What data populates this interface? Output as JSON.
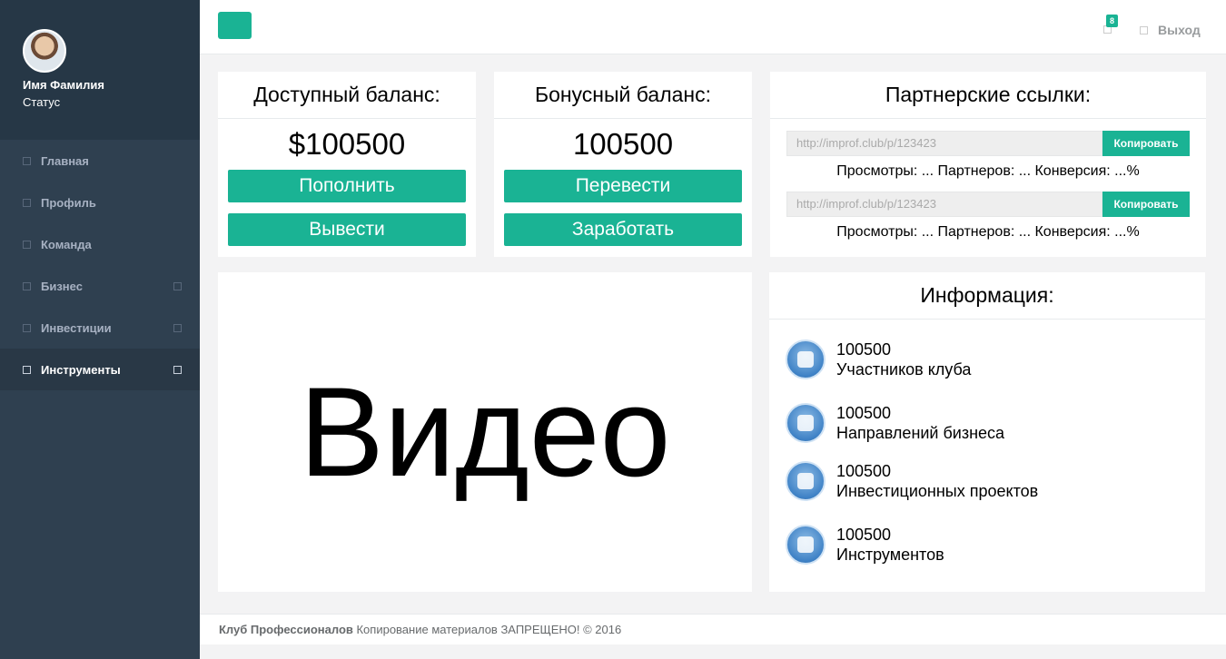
{
  "profile": {
    "name": "Имя Фамилия",
    "status": "Статус"
  },
  "nav": [
    {
      "label": "Главная",
      "icon": "home-icon",
      "arrow": false,
      "active": false
    },
    {
      "label": "Профиль",
      "icon": "user-icon",
      "arrow": false,
      "active": false
    },
    {
      "label": "Команда",
      "icon": "team-icon",
      "arrow": false,
      "active": false
    },
    {
      "label": "Бизнес",
      "icon": "business-icon",
      "arrow": true,
      "active": false
    },
    {
      "label": "Инвестиции",
      "icon": "investment-icon",
      "arrow": true,
      "active": false
    },
    {
      "label": "Инструменты",
      "icon": "tools-icon",
      "arrow": true,
      "active": true
    }
  ],
  "topbar": {
    "notification_count": "8",
    "logout_label": "Выход"
  },
  "balance": {
    "title": "Доступный баланс:",
    "value": "$100500",
    "topup_label": "Пополнить",
    "withdraw_label": "Вывести"
  },
  "bonus": {
    "title": "Бонусный баланс:",
    "value": "100500",
    "transfer_label": "Перевести",
    "earn_label": "Заработать"
  },
  "partner": {
    "title": "Партнерские ссылки:",
    "links": [
      {
        "url": "http://improf.club/p/123423",
        "copy_label": "Копировать",
        "stats": "Просмотры: ...   Партнеров: ... Конверсия: ...%"
      },
      {
        "url": "http://improf.club/p/123423",
        "copy_label": "Копировать",
        "stats": "Просмотры: ...   Партнеров: ... Конверсия: ...%"
      }
    ]
  },
  "video": {
    "label": "Видео"
  },
  "info": {
    "title": "Информация:",
    "items": [
      {
        "value": "100500",
        "label": "Участников клуба"
      },
      {
        "value": "100500",
        "label": "Направлений бизнеса"
      },
      {
        "value": "100500",
        "label": "Инвестиционных проектов"
      },
      {
        "value": "100500",
        "label": "Инструментов"
      }
    ]
  },
  "footer": {
    "brand": "Клуб Профессионалов",
    "text": " Копирование материалов ЗАПРЕЩЕНО! © 2016"
  },
  "colors": {
    "accent": "#1ab394",
    "sidebar": "#2f4050"
  }
}
